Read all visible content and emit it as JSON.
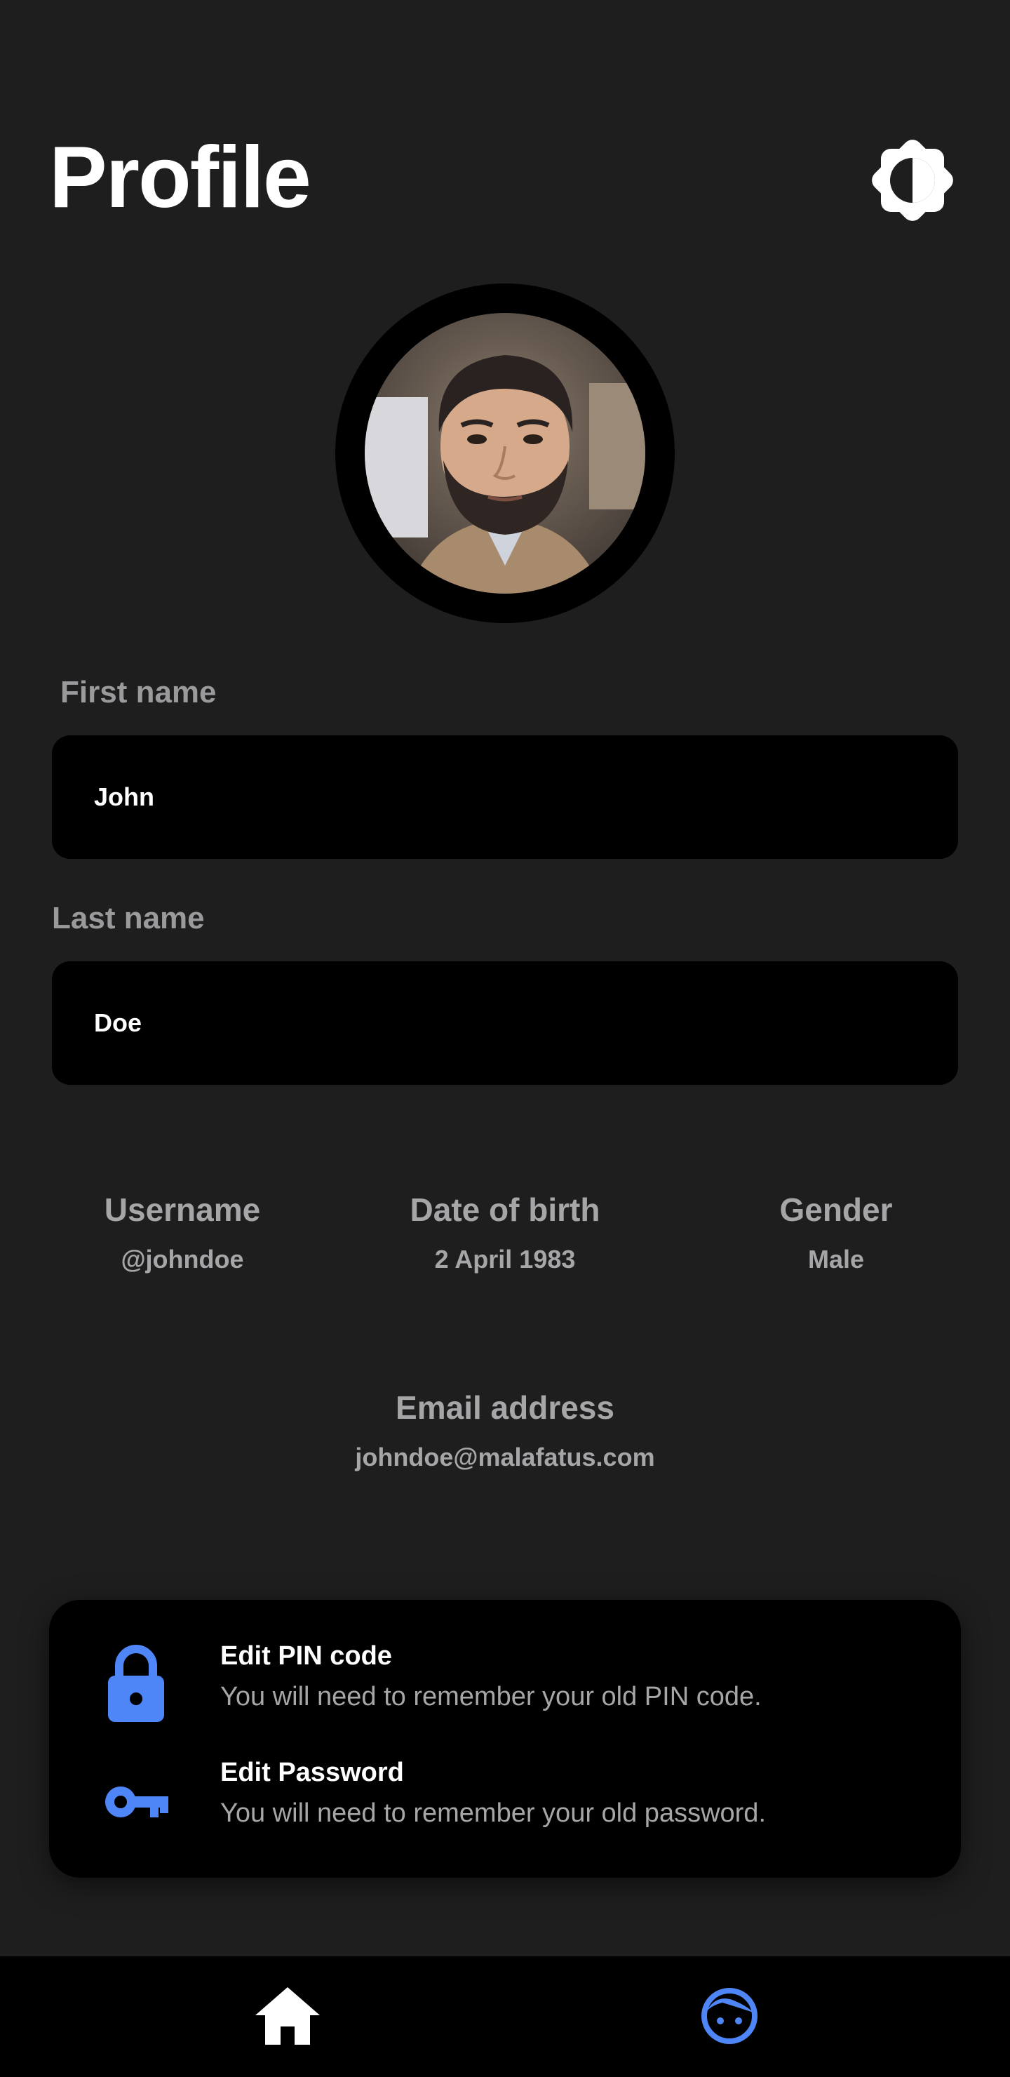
{
  "header": {
    "title": "Profile",
    "theme_toggle_icon": "brightness-contrast-icon"
  },
  "avatar": {
    "icon": "profile-photo"
  },
  "form": {
    "first_name": {
      "label": "First name",
      "value": "John"
    },
    "last_name": {
      "label": "Last name",
      "value": "Doe"
    }
  },
  "info": {
    "username": {
      "label": "Username",
      "value": "@johndoe"
    },
    "dob": {
      "label": "Date of birth",
      "value": "2 April 1983"
    },
    "gender": {
      "label": "Gender",
      "value": "Male"
    },
    "email": {
      "label": "Email address",
      "value": "johndoe@malafatus.com"
    }
  },
  "security": {
    "pin": {
      "icon": "lock-icon",
      "title": "Edit PIN code",
      "description": "You will need to remember your old PIN code."
    },
    "password": {
      "icon": "key-icon",
      "title": "Edit Password",
      "description": "You will need to remember your old password."
    }
  },
  "nav": {
    "home_icon": "home-icon",
    "profile_icon": "face-icon",
    "active": "profile"
  },
  "colors": {
    "background": "#1e1e1f",
    "surface": "#000000",
    "accent": "#4f86f7",
    "label_gray": "#9a9a9c",
    "text": "#ffffff"
  }
}
